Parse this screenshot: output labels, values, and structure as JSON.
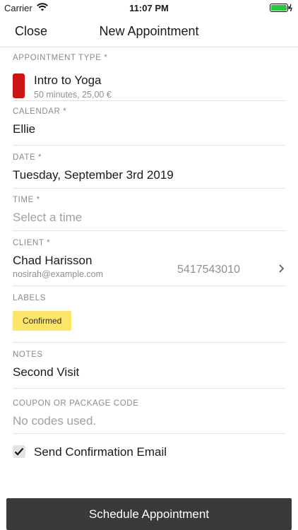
{
  "status_bar": {
    "carrier": "Carrier",
    "time": "11:07 PM"
  },
  "nav": {
    "close_label": "Close",
    "title": "New Appointment"
  },
  "form": {
    "appointment_type": {
      "label": "APPOINTMENT TYPE *",
      "name": "Intro to Yoga",
      "detail": "50 minutes, 25,00 €",
      "color": "#cc1414"
    },
    "calendar": {
      "label": "CALENDAR *",
      "value": "Ellie"
    },
    "date": {
      "label": "DATE *",
      "value": "Tuesday, September 3rd 2019"
    },
    "time": {
      "label": "TIME *",
      "placeholder": "Select a time"
    },
    "client": {
      "label": "CLIENT *",
      "name": "Chad Harisson",
      "email": "nosirah@example.com",
      "phone": "5417543010"
    },
    "labels": {
      "label": "LABELS",
      "badge": "Confirmed",
      "badge_color": "#fde56a"
    },
    "notes": {
      "label": "NOTES",
      "value": "Second Visit"
    },
    "coupon": {
      "label": "COUPON OR PACKAGE CODE",
      "placeholder": "No codes used."
    },
    "send_email": {
      "label": "Send Confirmation Email",
      "checked": true
    }
  },
  "footer": {
    "button_label": "Schedule Appointment"
  }
}
